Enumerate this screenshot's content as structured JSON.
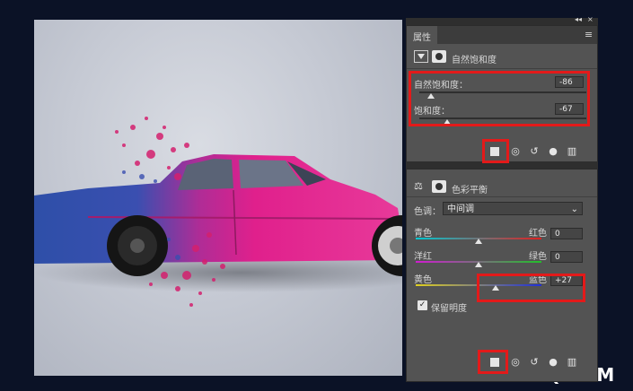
{
  "properties_panel": {
    "tab_label": "属性",
    "header_collapse_glyph": "◂◂",
    "close_glyph": "×",
    "menu_glyph": "≡",
    "adjustment_title": "自然饱和度",
    "vibrance_label": "自然饱和度：",
    "vibrance_value": "-86",
    "vibrance_fraction": 0.07,
    "saturation_label": "饱和度：",
    "saturation_value": "-67",
    "saturation_fraction": 0.165
  },
  "color_balance_panel": {
    "adjustment_title": "色彩平衡",
    "tone_label": "色调：",
    "tone_value": "中间调",
    "sliders": [
      {
        "left": "青色",
        "right": "红色",
        "value": "0",
        "fraction": 0.5,
        "gradient": "linear-gradient(90deg,#00c8d2,#e02020)"
      },
      {
        "left": "洋红",
        "right": "绿色",
        "value": "0",
        "fraction": 0.5,
        "gradient": "linear-gradient(90deg,#d01cd0,#22c02a)"
      },
      {
        "left": "黄色",
        "right": "蓝色",
        "value": "+27",
        "fraction": 0.635,
        "gradient": "linear-gradient(90deg,#e0d020,#2030d8)"
      }
    ],
    "preserve_luminosity_label": "保留明度",
    "preserve_luminosity_checked": true
  },
  "footer_icons": [
    "clip-to-layer-icon",
    "view-previous-icon",
    "reset-icon",
    "visibility-eye-icon",
    "trash-icon"
  ],
  "watermark": "UiBQ.CoM",
  "colors": {
    "highlight_red": "#e31a1a",
    "car_pink": "#e0208c",
    "car_blue": "#2e4fa8"
  }
}
